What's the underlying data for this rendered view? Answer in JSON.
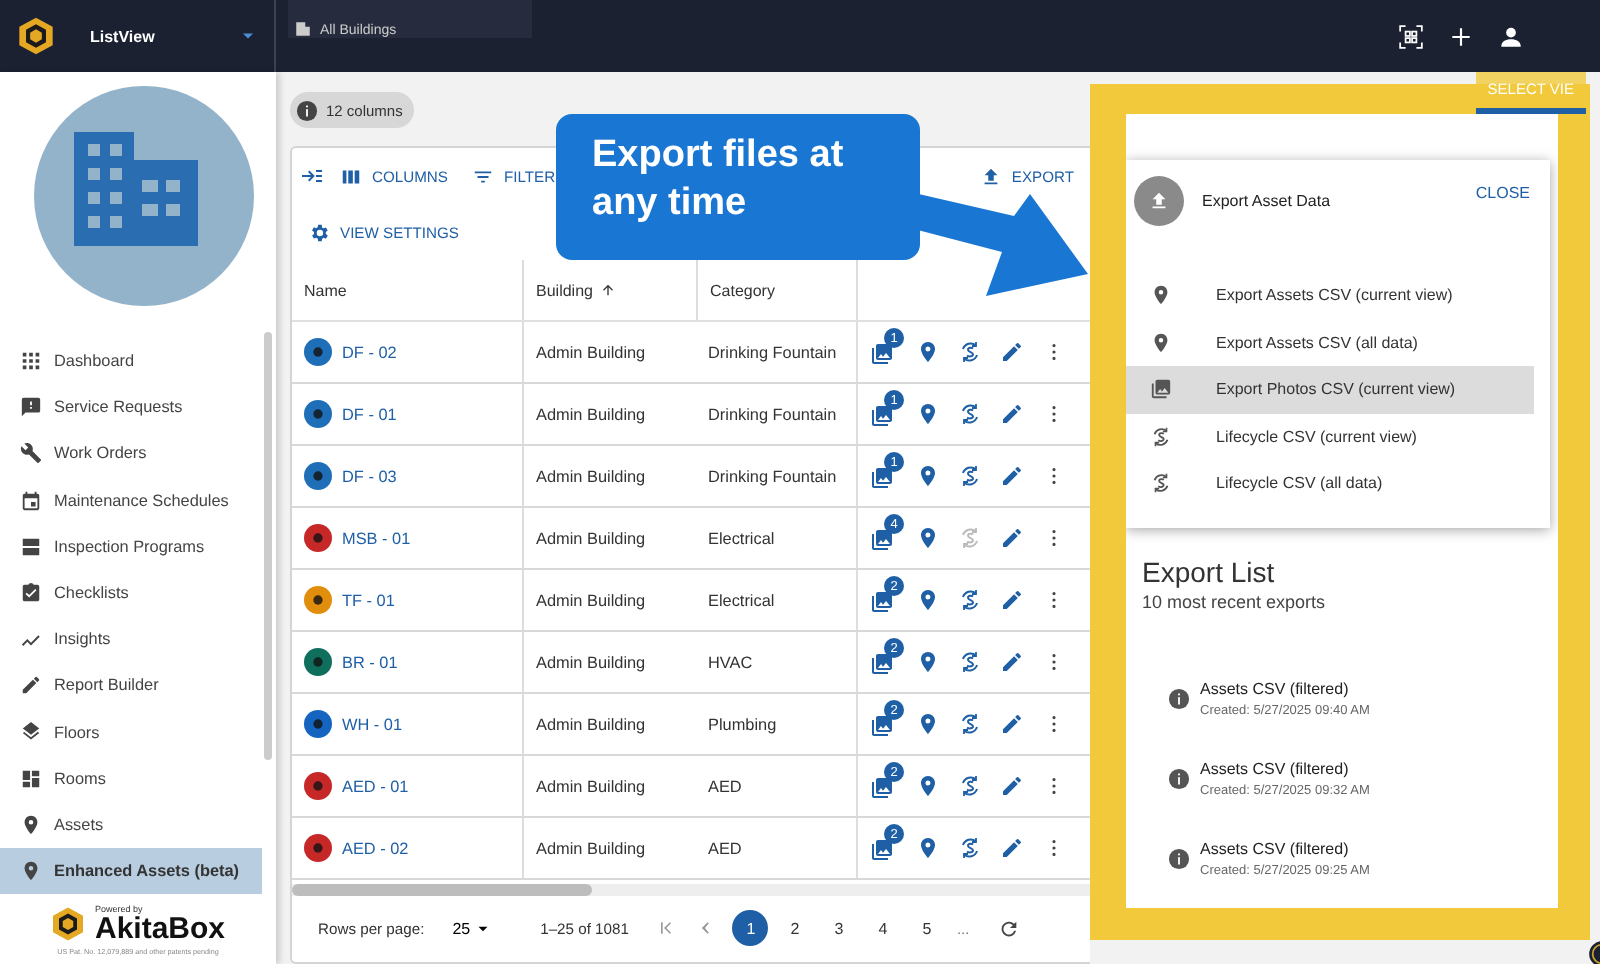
{
  "app": {
    "title": "ListView",
    "scope": "All Buildings"
  },
  "sidebar": {
    "items": [
      {
        "label": "Dashboard",
        "selected": false
      },
      {
        "label": "Service Requests",
        "selected": false
      },
      {
        "label": "Work Orders",
        "selected": false
      },
      {
        "label": "Maintenance Schedules",
        "selected": false
      },
      {
        "label": "Inspection Programs",
        "selected": false
      },
      {
        "label": "Checklists",
        "selected": false
      },
      {
        "label": "Insights",
        "selected": false
      },
      {
        "label": "Report Builder",
        "selected": false
      },
      {
        "label": "Floors",
        "selected": false
      },
      {
        "label": "Rooms",
        "selected": false
      },
      {
        "label": "Assets",
        "selected": false
      },
      {
        "label": "Enhanced Assets (beta)",
        "selected": true
      }
    ],
    "powered_by": "Powered by",
    "brand": "AkitaBox",
    "patent": "US Pat. No. 12,079,889 and other patents pending"
  },
  "column_count": "12 columns",
  "toolbar": {
    "columns": "COLUMNS",
    "filter": "FILTER",
    "export": "EXPORT",
    "view_settings": "VIEW SETTINGS"
  },
  "table": {
    "columns": [
      {
        "label": "Name",
        "sorted": false
      },
      {
        "label": "Building",
        "sorted": true
      },
      {
        "label": "Category",
        "sorted": false
      }
    ],
    "rows": [
      {
        "name": "DF - 02",
        "color": "#1e6fb8",
        "building": "Admin Building",
        "category": "Drinking Fountain",
        "photos": "1",
        "lifecycle_enabled": true
      },
      {
        "name": "DF - 01",
        "color": "#1e6fb8",
        "building": "Admin Building",
        "category": "Drinking Fountain",
        "photos": "1",
        "lifecycle_enabled": true
      },
      {
        "name": "DF - 03",
        "color": "#1e6fb8",
        "building": "Admin Building",
        "category": "Drinking Fountain",
        "photos": "1",
        "lifecycle_enabled": true
      },
      {
        "name": "MSB - 01",
        "color": "#c62828",
        "building": "Admin Building",
        "category": "Electrical",
        "photos": "4",
        "lifecycle_enabled": false
      },
      {
        "name": "TF - 01",
        "color": "#e08e0b",
        "building": "Admin Building",
        "category": "Electrical",
        "photos": "2",
        "lifecycle_enabled": true
      },
      {
        "name": "BR - 01",
        "color": "#0f6e5c",
        "building": "Admin Building",
        "category": "HVAC",
        "photos": "2",
        "lifecycle_enabled": true
      },
      {
        "name": "WH - 01",
        "color": "#1565c0",
        "building": "Admin Building",
        "category": "Plumbing",
        "photos": "2",
        "lifecycle_enabled": true
      },
      {
        "name": "AED - 01",
        "color": "#c62828",
        "building": "Admin Building",
        "category": "AED",
        "photos": "2",
        "lifecycle_enabled": true
      },
      {
        "name": "AED - 02",
        "color": "#c62828",
        "building": "Admin Building",
        "category": "AED",
        "photos": "2",
        "lifecycle_enabled": true
      }
    ]
  },
  "pagination": {
    "rows_per_page_label": "Rows per page:",
    "rows_per_page": "25",
    "range": "1–25 of 1081",
    "pages": [
      {
        "label": "1",
        "selected": true
      },
      {
        "label": "2",
        "selected": false
      },
      {
        "label": "3",
        "selected": false
      },
      {
        "label": "4",
        "selected": false
      },
      {
        "label": "5",
        "selected": false
      }
    ],
    "ellipsis": "..."
  },
  "callout": "Export files at any time",
  "export_panel": {
    "select_view": "SELECT VIE",
    "title": "Export Asset Data",
    "close": "CLOSE",
    "options": [
      {
        "label": "Export Assets CSV (current view)",
        "selected": false
      },
      {
        "label": "Export Assets CSV (all data)",
        "selected": false
      },
      {
        "label": "Export Photos CSV (current view)",
        "selected": true
      },
      {
        "label": "Lifecycle CSV (current view)",
        "selected": false
      },
      {
        "label": "Lifecycle CSV (all data)",
        "selected": false
      }
    ],
    "list_title": "Export List",
    "list_subtitle": "10 most recent exports",
    "exports": [
      {
        "name": "Assets CSV (filtered)",
        "created": "Created: 5/27/2025 09:40 AM"
      },
      {
        "name": "Assets CSV (filtered)",
        "created": "Created: 5/27/2025 09:32 AM"
      },
      {
        "name": "Assets CSV (filtered)",
        "created": "Created: 5/27/2025 09:25 AM"
      }
    ]
  }
}
